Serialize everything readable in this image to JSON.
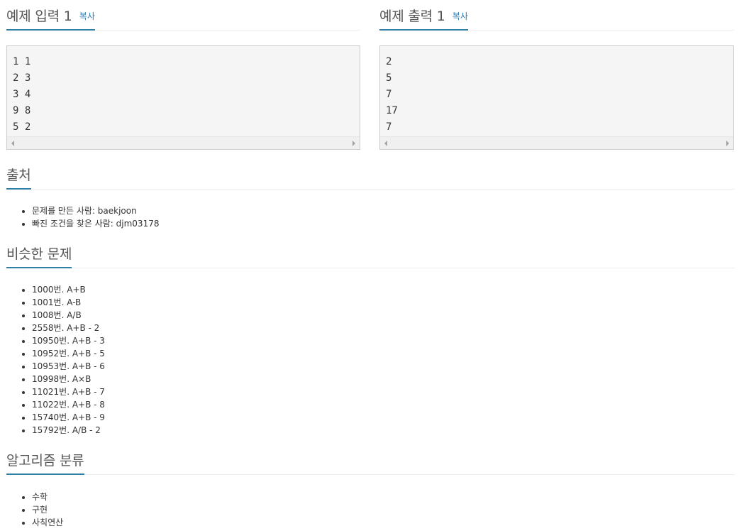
{
  "sample_input": {
    "title": "예제 입력 1",
    "copy_label": "복사",
    "lines": "1 1\n2 3\n3 4\n9 8\n5 2"
  },
  "sample_output": {
    "title": "예제 출력 1",
    "copy_label": "복사",
    "lines": "2\n5\n7\n17\n7"
  },
  "source": {
    "title": "출처",
    "items": [
      "문제를 만든 사람: baekjoon",
      "빠진 조건을 찾은 사람: djm03178"
    ]
  },
  "similar": {
    "title": "비슷한 문제",
    "items": [
      "1000번. A+B",
      "1001번. A-B",
      "1008번. A/B",
      "2558번. A+B - 2",
      "10950번. A+B - 3",
      "10952번. A+B - 5",
      "10953번. A+B - 6",
      "10998번. A×B",
      "11021번. A+B - 7",
      "11022번. A+B - 8",
      "15740번. A+B - 9",
      "15792번. A/B - 2"
    ]
  },
  "algorithms": {
    "title": "알고리즘 분류",
    "items": [
      "수학",
      "구현",
      "사칙연산"
    ]
  },
  "colors": {
    "accent": "#2f7ea5",
    "link": "#2a7bb0",
    "sample_bg": "#f5f5f5"
  }
}
